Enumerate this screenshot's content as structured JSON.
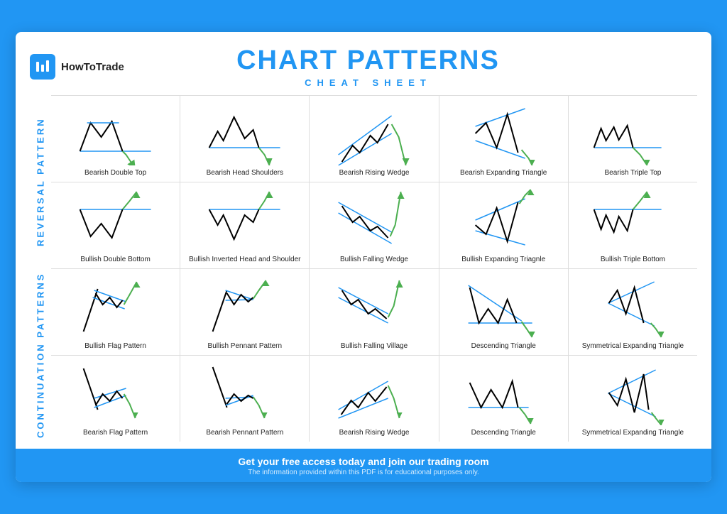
{
  "header": {
    "logo_text": "HowToTrade",
    "main_title": "CHART PATTERNS",
    "sub_title": "CHEAT SHEET"
  },
  "sections": {
    "reversal": "REVERSAL PATTERN",
    "continuation": "CONTINUATION PATTERNS"
  },
  "patterns": {
    "row1": [
      {
        "name": "Bearish Double Top"
      },
      {
        "name": "Bearish Head Shoulders"
      },
      {
        "name": "Bearish Rising Wedge"
      },
      {
        "name": "Bearish Expanding Triangle"
      },
      {
        "name": "Bearish Triple Top"
      }
    ],
    "row2": [
      {
        "name": "Bullish Double Bottom"
      },
      {
        "name": "Bullish Inverted Head and Shoulder"
      },
      {
        "name": "Bullish Falling Wedge"
      },
      {
        "name": "Bullish Expanding Triagnle"
      },
      {
        "name": "Bullish Triple Bottom"
      }
    ],
    "row3": [
      {
        "name": "Bullish Flag Pattern"
      },
      {
        "name": "Bullish Pennant Pattern"
      },
      {
        "name": "Bullish Falling Village"
      },
      {
        "name": "Descending Triangle"
      },
      {
        "name": "Symmetrical Expanding Triangle"
      }
    ],
    "row4": [
      {
        "name": "Bearish Flag Pattern"
      },
      {
        "name": "Bearish Pennant Pattern"
      },
      {
        "name": "Bearish Rising Wedge"
      },
      {
        "name": "Descending Triangle"
      },
      {
        "name": "Symmetrical Expanding Triangle"
      }
    ]
  },
  "footer": {
    "main": "Get your free access today and join our trading room",
    "sub": "The information provided within this PDF is for educational purposes only."
  }
}
